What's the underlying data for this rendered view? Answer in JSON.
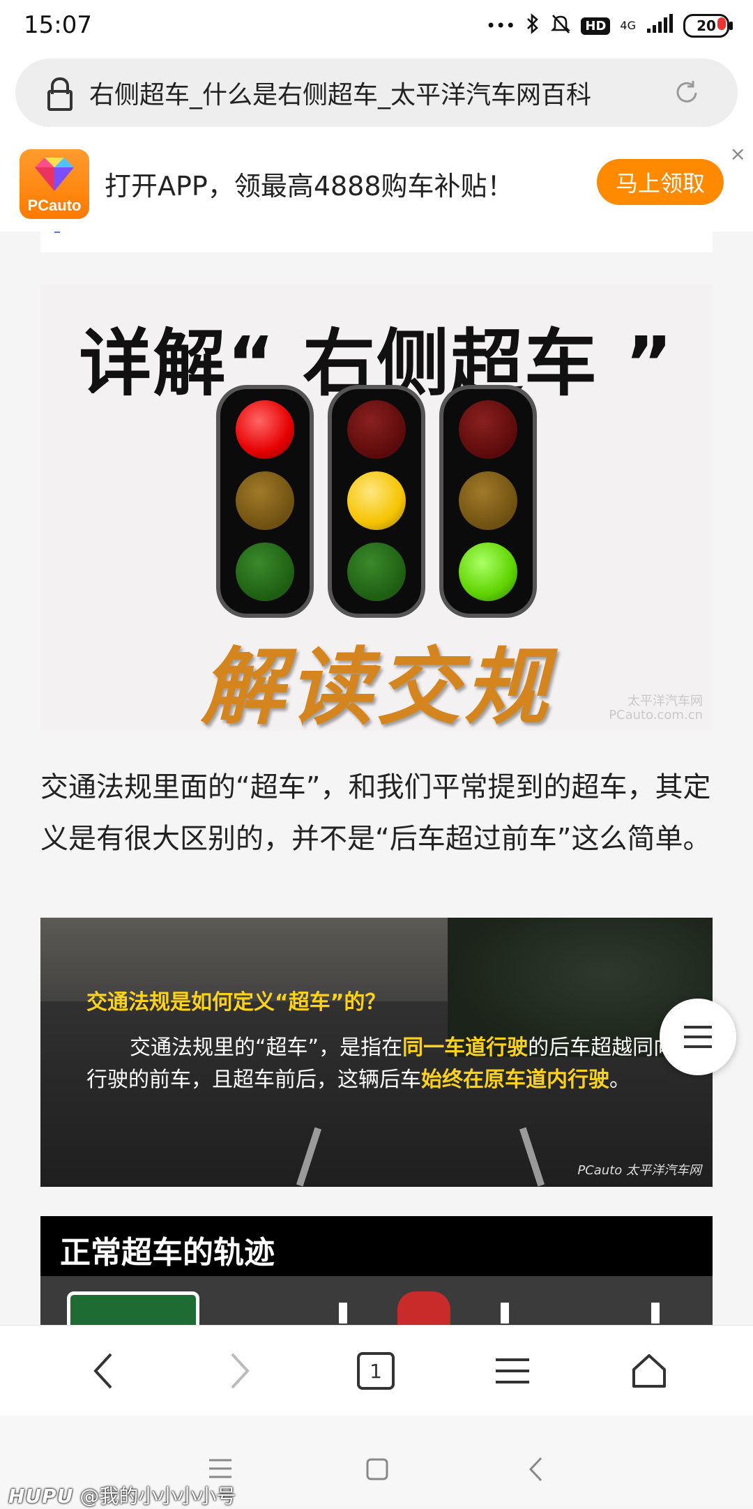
{
  "status_bar": {
    "time": "15:07",
    "dots": "•••",
    "hd": "HD",
    "network": "4G",
    "battery": "20"
  },
  "url_bar": {
    "title": "右侧超车_什么是右侧超车_太平洋汽车网百科"
  },
  "app_banner": {
    "logo_text": "PCauto",
    "text": "打开APP，领最高4888购车补贴！",
    "button": "马上领取",
    "close": "×"
  },
  "article": {
    "image1": {
      "title": "详解“ 右侧超车 ”",
      "subtitle": "解读交规",
      "watermark_line1": "太平洋汽车网",
      "watermark_line2": "PCauto.com.cn"
    },
    "paragraph": "交通法规里面的“超车”，和我们平常提到的超车，其定义是有很大区别的，并不是“后车超过前车”这么简单。",
    "image2": {
      "question": "交通法规是如何定义“超车”的？",
      "answer_part1": "交通法规里的“超车”，是指在",
      "answer_hl1": "同一车道行驶",
      "answer_part2": "的后车超越同向行驶的前车，且超车前后，这辆后车",
      "answer_hl2": "始终在原车道内行驶",
      "answer_part3": "。",
      "watermark": "PCauto 太平洋汽车网"
    },
    "image3": {
      "title": "正常超车的轨迹"
    }
  },
  "browser_nav": {
    "tab_count": "1"
  },
  "watermark": {
    "brand": "HUPU",
    "user": "@我的小小小小号"
  },
  "colors": {
    "accent": "#ff8a00",
    "highlight": "#ffd21a"
  }
}
